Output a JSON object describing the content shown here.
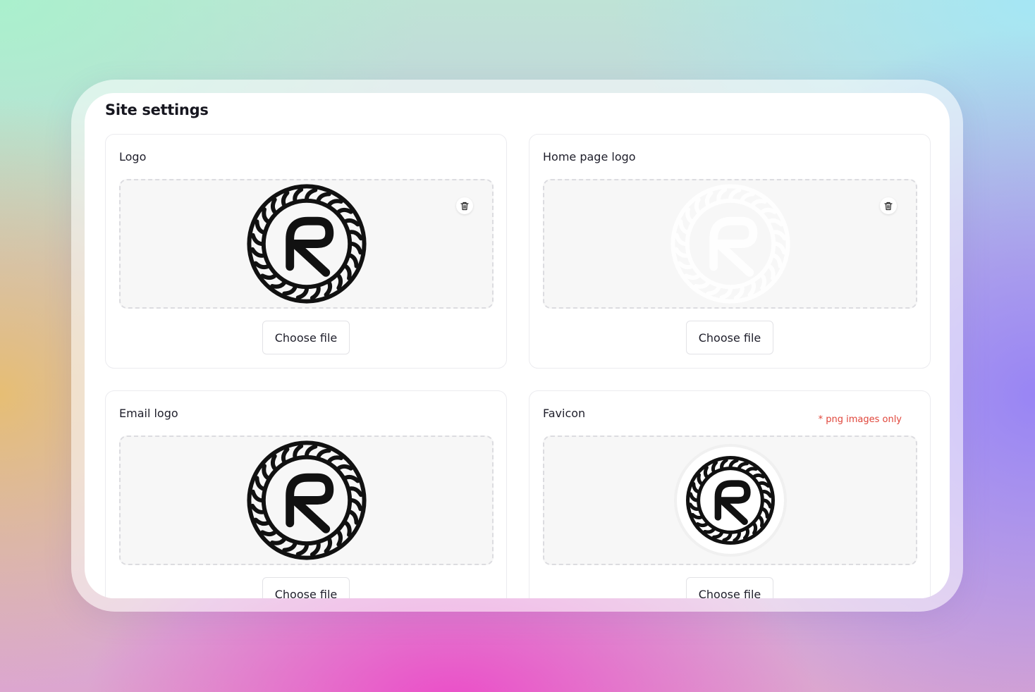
{
  "page": {
    "title": "Site settings"
  },
  "cards": {
    "logo": {
      "label": "Logo",
      "button": "Choose file"
    },
    "home_page_logo": {
      "label": "Home page logo",
      "button": "Choose file"
    },
    "email_logo": {
      "label": "Email logo",
      "button": "Choose file"
    },
    "favicon": {
      "label": "Favicon",
      "note": "* png images only",
      "button": "Choose file"
    }
  },
  "icons": {
    "delete": "trash-icon",
    "brand": "logo-emblem"
  },
  "colors": {
    "note": "#e0453a",
    "logo_dark": "#111111",
    "logo_light": "#ffffff"
  }
}
